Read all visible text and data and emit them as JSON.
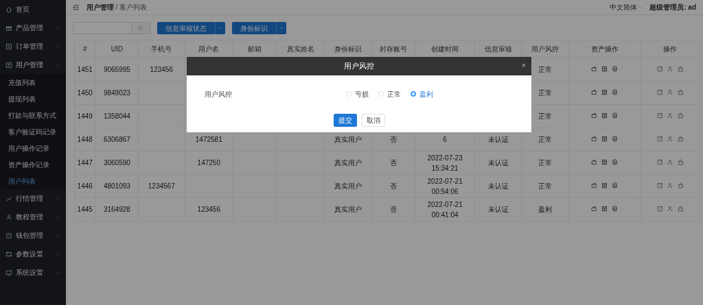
{
  "sidebar": {
    "items": [
      {
        "label": "首页",
        "kind": "link"
      },
      {
        "label": "产品管理",
        "kind": "group",
        "expanded": false
      },
      {
        "label": "订单管理",
        "kind": "group",
        "expanded": false
      },
      {
        "label": "用户管理",
        "kind": "group",
        "expanded": true,
        "children": [
          {
            "label": "充值列表",
            "selected": false
          },
          {
            "label": "提现列表",
            "selected": false
          },
          {
            "label": "打款与联系方式",
            "selected": false
          },
          {
            "label": "客户验证码记录",
            "selected": false
          },
          {
            "label": "用户操作记录",
            "selected": false
          },
          {
            "label": "资产操作记录",
            "selected": false
          },
          {
            "label": "用户列表",
            "selected": true
          }
        ]
      },
      {
        "label": "行情管理",
        "kind": "group",
        "expanded": false
      },
      {
        "label": "教程管理",
        "kind": "group",
        "expanded": false
      },
      {
        "label": "钱包管理",
        "kind": "group",
        "expanded": false
      },
      {
        "label": "参数设置",
        "kind": "group",
        "expanded": false
      },
      {
        "label": "系统设置",
        "kind": "group",
        "expanded": false
      }
    ]
  },
  "breadcrumb": [
    "用户管理",
    "客户列表"
  ],
  "breadcrumb_separator": "/",
  "header": {
    "language": "中文简体",
    "user": "超级管理员: ad"
  },
  "toolbar": {
    "filters": [
      "信息审核状态",
      "身份标识"
    ]
  },
  "table": {
    "columns": [
      "#",
      "UID",
      "手机号",
      "用户名",
      "邮箱",
      "真实姓名",
      "身份标识",
      "封存账号",
      "创建时间",
      "信息审核",
      "用户风控",
      "资产操作",
      "操作"
    ],
    "rows": [
      [
        "1451",
        "9065995",
        "123456",
        null,
        null,
        null,
        null,
        null,
        null,
        null,
        "正常"
      ],
      [
        "1450",
        "9849023",
        null,
        null,
        null,
        null,
        null,
        null,
        null,
        null,
        "正常"
      ],
      [
        "1449",
        "1358044",
        null,
        null,
        null,
        null,
        null,
        null,
        null,
        null,
        "正常"
      ],
      [
        "1448",
        "6306867",
        null,
        "1472581",
        null,
        null,
        "真实用户",
        "否",
        "6",
        "未认证",
        "正常"
      ],
      [
        "1447",
        "3060590",
        null,
        "147250",
        null,
        null,
        "真实用户",
        "否",
        "2022-07-23 15:34:21",
        "未认证",
        "正常"
      ],
      [
        "1446",
        "4801093",
        "1234567",
        null,
        null,
        null,
        "真实用户",
        "否",
        "2022-07-21 00:54:06",
        "未认证",
        "正常"
      ],
      [
        "1445",
        "3164928",
        null,
        "123456",
        null,
        null,
        "真实用户",
        "否",
        "2022-07-21 00:41:04",
        "未认证",
        "盈利"
      ]
    ]
  },
  "modal": {
    "title": "用户风控",
    "close": "×",
    "field_label": "用户风控",
    "options": [
      {
        "label": "亏损",
        "selected": false
      },
      {
        "label": "正常",
        "selected": false
      },
      {
        "label": "盈利",
        "selected": true
      }
    ],
    "buttons": [
      {
        "label": "提交",
        "kind": "primary"
      },
      {
        "label": "取消",
        "kind": "default"
      }
    ]
  }
}
